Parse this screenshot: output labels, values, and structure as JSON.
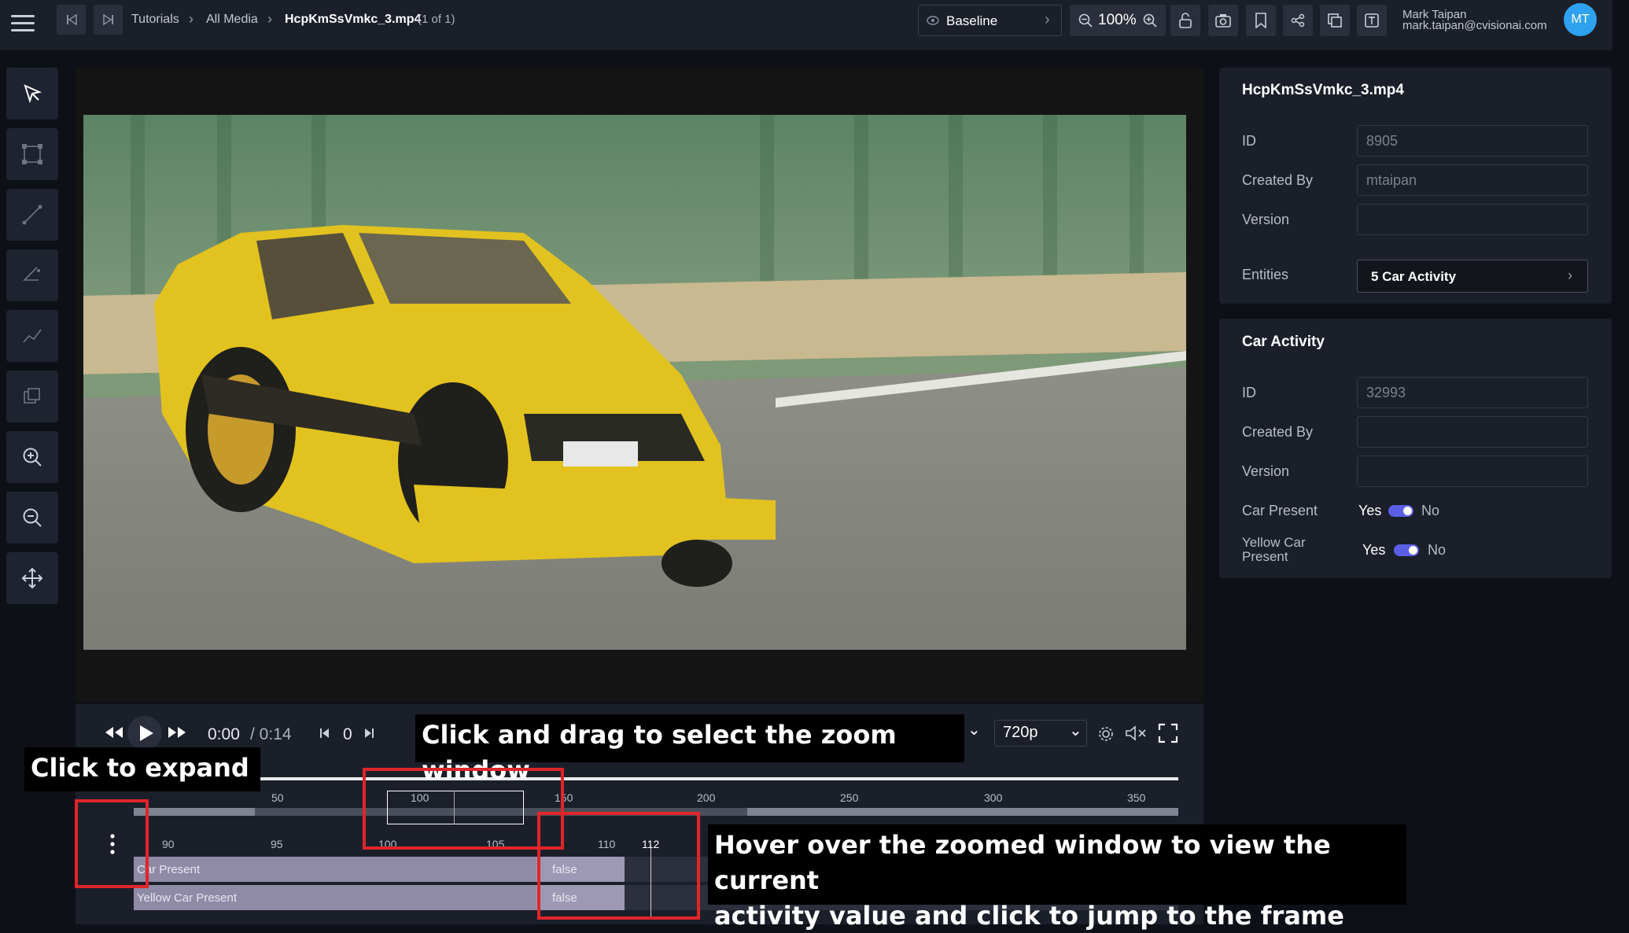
{
  "topbar": {
    "breadcrumb": [
      "Tutorials",
      "All Media"
    ],
    "file_name": "HcpKmSsVmkc_3.mp4",
    "file_count": "(1 of 1)",
    "baseline_label": "Baseline",
    "zoom_level": "100%",
    "user_name": "Mark Taipan",
    "user_email": "mark.taipan@cvisionai.com",
    "avatar_initials": "MT"
  },
  "media_panel": {
    "title": "HcpKmSsVmkc_3.mp4",
    "id_label": "ID",
    "id_value": "8905",
    "created_by_label": "Created By",
    "created_by_value": "mtaipan",
    "version_label": "Version",
    "version_value": "",
    "entities_label": "Entities",
    "entities_value": "5 Car Activity"
  },
  "activity_panel": {
    "title": "Car Activity",
    "id_label": "ID",
    "id_value": "32993",
    "created_by_label": "Created By",
    "created_by_value": "",
    "version_label": "Version",
    "version_value": "",
    "car_present_label": "Car Present",
    "yellow_car_label_1": "Yellow Car",
    "yellow_car_label_2": "Present",
    "yes": "Yes",
    "no": "No"
  },
  "player": {
    "current_time": "0:00",
    "total_time": "/ 0:14",
    "frame": "0",
    "quality": "720p",
    "timeline_ticks": [
      "50",
      "100",
      "150",
      "200",
      "250",
      "300",
      "350"
    ],
    "zoom_ticks": [
      "90",
      "95",
      "100",
      "105",
      "110",
      "112"
    ],
    "tracks": [
      {
        "label": "Car Present",
        "value": "false"
      },
      {
        "label": "Yellow Car Present",
        "value": "false"
      }
    ]
  },
  "callouts": {
    "expand": "Click to expand",
    "zoom_window": "Click and drag to select the zoom window",
    "hover_line1": "Hover over the zoomed window to view the current",
    "hover_line2": "activity value and click to jump to the frame"
  },
  "colors": {
    "accent": "#2ea2f0",
    "toggle": "#5b5fe6",
    "callout_box": "#e0262a",
    "track": "#8f8aa6"
  }
}
